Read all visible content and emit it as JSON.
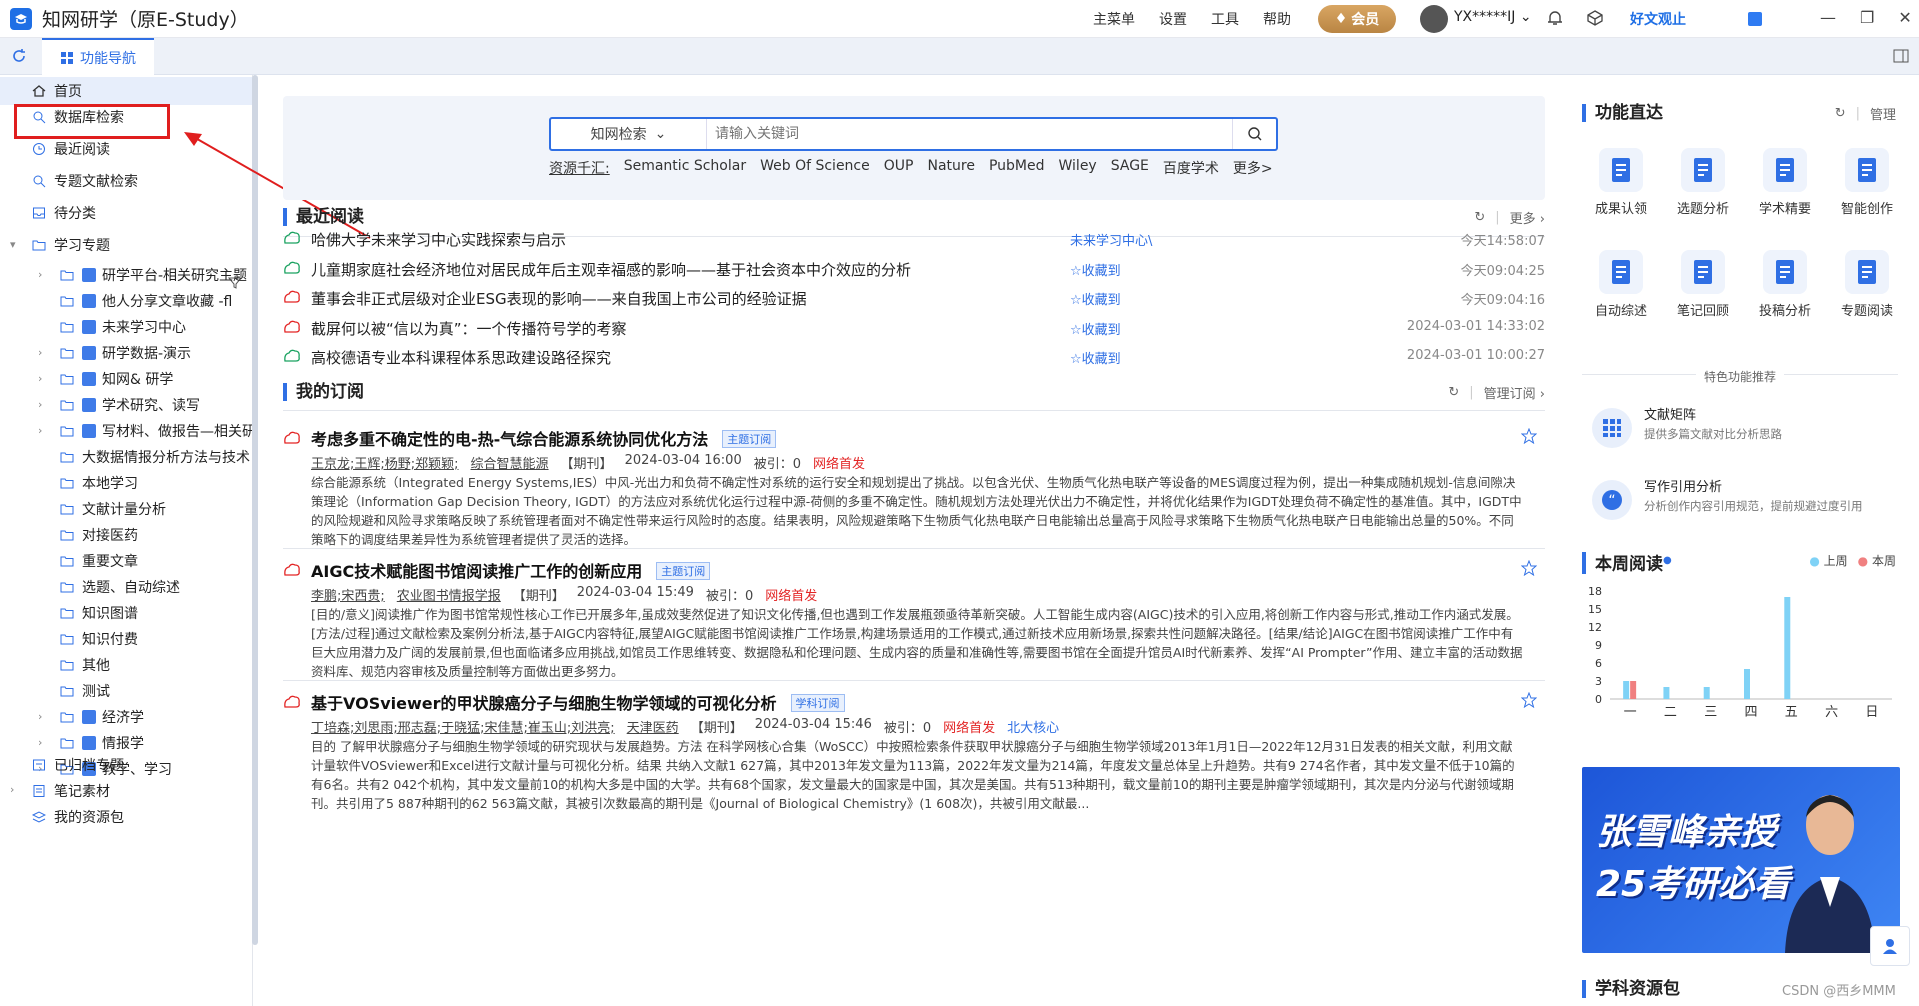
{
  "app": {
    "title": "知网研学（原E-Study）"
  },
  "topmenu": [
    "主菜单",
    "设置",
    "工具",
    "帮助"
  ],
  "vip_label": "会员",
  "user": {
    "name": "YX*****IJ"
  },
  "haowen": "好文观止",
  "tab": {
    "label": "功能导航"
  },
  "sidebar": {
    "items": [
      {
        "label": "首页"
      },
      {
        "label": "数据库检索"
      },
      {
        "label": "最近阅读"
      },
      {
        "label": "专题文献检索"
      },
      {
        "label": "待分类"
      },
      {
        "label": "学习专题"
      }
    ],
    "topics": [
      "研学平台-相关研究主题",
      "他人分享文章收藏 -fl",
      "未来学习中心",
      "研学数据-演示",
      "知网& 研学",
      "学术研究、读写",
      "写材料、做报告—相关研究",
      "大数据情报分析方法与技术",
      "本地学习",
      "文献计量分析",
      "对接医药",
      "重要文章",
      "选题、自动综述",
      "知识图谱",
      "知识付费",
      "其他",
      "测试",
      "经济学",
      "情报学",
      "教学、学习"
    ],
    "bottom": [
      {
        "label": "已归档专题"
      },
      {
        "label": "笔记素材"
      },
      {
        "label": "我的资源包"
      }
    ]
  },
  "search": {
    "scope": "知网检索",
    "placeholder": "请输入关键词",
    "source_label": "资源千汇:",
    "sources": [
      "Semantic Scholar",
      "Web Of Science",
      "OUP",
      "Nature",
      "PubMed",
      "Wiley",
      "SAGE",
      "百度学术",
      "更多>"
    ]
  },
  "recent": {
    "title": "最近阅读",
    "more": "更多",
    "rows": [
      {
        "title": "哈佛大学未来学习中心实践探索与启示",
        "folder": "未来学习中心\\",
        "time": "今天14:58:07",
        "type": "caj"
      },
      {
        "title": "儿童期家庭社会经济地位对居民成年后主观幸福感的影响——基于社会资本中介效应的分析",
        "folder": "☆收藏到",
        "time": "今天09:04:25",
        "type": "caj"
      },
      {
        "title": "董事会非正式层级对企业ESG表现的影响——来自我国上市公司的经验证据",
        "folder": "☆收藏到",
        "time": "今天09:04:16",
        "type": "pdf"
      },
      {
        "title": "截屏何以被“信以为真”：一个传播符号学的考察",
        "folder": "☆收藏到",
        "time": "2024-03-01 14:33:02",
        "type": "pdf"
      },
      {
        "title": "高校德语专业本科课程体系思政建设路径探究",
        "folder": "☆收藏到",
        "time": "2024-03-01 10:00:27",
        "type": "caj"
      }
    ]
  },
  "subs": {
    "title": "我的订阅",
    "manage": "管理订阅",
    "items": [
      {
        "title": "考虑多重不确定性的电-热-气综合能源系统协同优化方法",
        "tag": "主题订阅",
        "authors": "王京龙;王辉;杨野;郑颖颖;",
        "journal": "综合智慧能源",
        "type": "【期刊】",
        "date": "2024-03-04 16:00",
        "cited": "被引：0",
        "first": "网络首发",
        "core": "",
        "abstract": "综合能源系统（Integrated Energy Systems,IES）中风-光出力和负荷不确定性对系统的运行安全和规划提出了挑战。以包含光伏、生物质气化热电联产等设备的MES调度过程为例，提出一种集成随机规划-信息间隙决策理论（Information Gap Decision Theory, IGDT）的方法应对系统优化运行过程中源-荷侧的多重不确定性。随机规划方法处理光伏出力不确定性，并将优化结果作为IGDT处理负荷不确定性的基准值。其中，IGDT中的风险规避和风险寻求策略反映了系统管理者面对不确定性带来运行风险时的态度。结果表明，风险规避策略下生物质气化热电联产日电能输出总量高于风险寻求策略下生物质气化热电联产日电能输出总量的50%。不同策略下的调度结果差异性为系统管理者提供了灵活的选择。"
      },
      {
        "title": "AIGC技术赋能图书馆阅读推广工作的创新应用",
        "tag": "主题订阅",
        "authors": "李鹏;宋西贵;",
        "journal": "农业图书情报学报",
        "type": "【期刊】",
        "date": "2024-03-04 15:49",
        "cited": "被引：0",
        "first": "网络首发",
        "core": "",
        "abstract": "[目的/意义]阅读推广作为图书馆常规性核心工作已开展多年,虽成效斐然促进了知识文化传播,但也遇到工作发展瓶颈亟待革新突破。人工智能生成内容(AIGC)技术的引入应用,将创新工作内容与形式,推动工作内涵式发展。[方法/过程]通过文献检索及案例分析法,基于AIGC内容特征,展望AIGC赋能图书馆阅读推广工作场景,构建场景适用的工作模式,通过新技术应用新场景,探索共性问题解决路径。[结果/结论]AIGC在图书馆阅读推广工作中有巨大应用潜力及广阔的发展前景,但也面临诸多应用挑战,如馆员工作思维转变、数据隐私和伦理问题、生成内容的质量和准确性等,需要图书馆在全面提升馆员AI时代新素养、发挥“AI Prompter”作用、建立丰富的活动数据资料库、规范内容审核及质量控制等方面做出更多努力。"
      },
      {
        "title": "基于VOSviewer的甲状腺癌分子与细胞生物学领域的可视化分析",
        "tag": "学科订阅",
        "authors": "丁培森;刘思雨;邢志磊;于晓猛;宋佳慧;崔玉山;刘洪亮;",
        "journal": "天津医药",
        "type": "【期刊】",
        "date": "2024-03-04 15:46",
        "cited": "被引：0",
        "first": "网络首发",
        "core": "北大核心",
        "abstract": "目的 了解甲状腺癌分子与细胞生物学领域的研究现状与发展趋势。方法 在科学网核心合集（WoSCC）中按照检索条件获取甲状腺癌分子与细胞生物学领域2013年1月1日—2022年12月31日发表的相关文献，利用文献计量软件VOSviewer和Excel进行文献计量与可视化分析。结果 共纳入文献1 627篇，其中2013年发文量为113篇，2022年发文量为214篇，年度发文量总体呈上升趋势。共有9 274名作者，其中发文量不低于10篇的有6名。共有2 042个机构，其中发文量前10的机构大多是中国的大学。共有68个国家，发文量最大的国家是中国，其次是美国。共有513种期刊，载文量前10的期刊主要是肿瘤学领域期刊，其次是内分泌与代谢领域期刊。共引用了5 887种期刊的62 563篇文献，其被引次数最高的期刊是《Journal of Biological Chemistry》(1 608次)，共被引用文献最..."
      }
    ]
  },
  "quick": {
    "title": "功能直达",
    "manage": "管理",
    "items": [
      "成果认领",
      "选题分析",
      "学术精要",
      "智能创作",
      "自动综述",
      "笔记回顾",
      "投稿分析",
      "专题阅读"
    ]
  },
  "featured": {
    "title": "特色功能推荐",
    "items": [
      {
        "name": "文献矩阵",
        "desc": "提供多篇文献对比分析思路"
      },
      {
        "name": "写作引用分析",
        "desc": "分析创作内容引用规范，提前规避过度引用"
      }
    ]
  },
  "weekly": {
    "title": "本周阅读",
    "legend": [
      "上周",
      "本周"
    ]
  },
  "chart_data": {
    "type": "bar",
    "categories": [
      "一",
      "二",
      "三",
      "四",
      "五",
      "六",
      "日"
    ],
    "series": [
      {
        "name": "上周",
        "values": [
          3,
          2,
          2,
          5,
          17,
          0,
          0
        ],
        "color": "#7fd2f6"
      },
      {
        "name": "本周",
        "values": [
          3,
          0,
          0,
          0,
          0,
          0,
          0
        ],
        "color": "#f08080"
      }
    ],
    "ylim": [
      0,
      18
    ],
    "yticks": [
      0,
      3,
      6,
      9,
      12,
      15,
      18
    ]
  },
  "banner": {
    "line1": "张雪峰亲授",
    "line2": "25考研必看"
  },
  "resource": {
    "title": "学科资源包"
  },
  "watermark": "CSDN @西乡MMM",
  "colors": {
    "accent": "#2f6fe4",
    "red": "#e32525",
    "vip": "#c4934f"
  }
}
